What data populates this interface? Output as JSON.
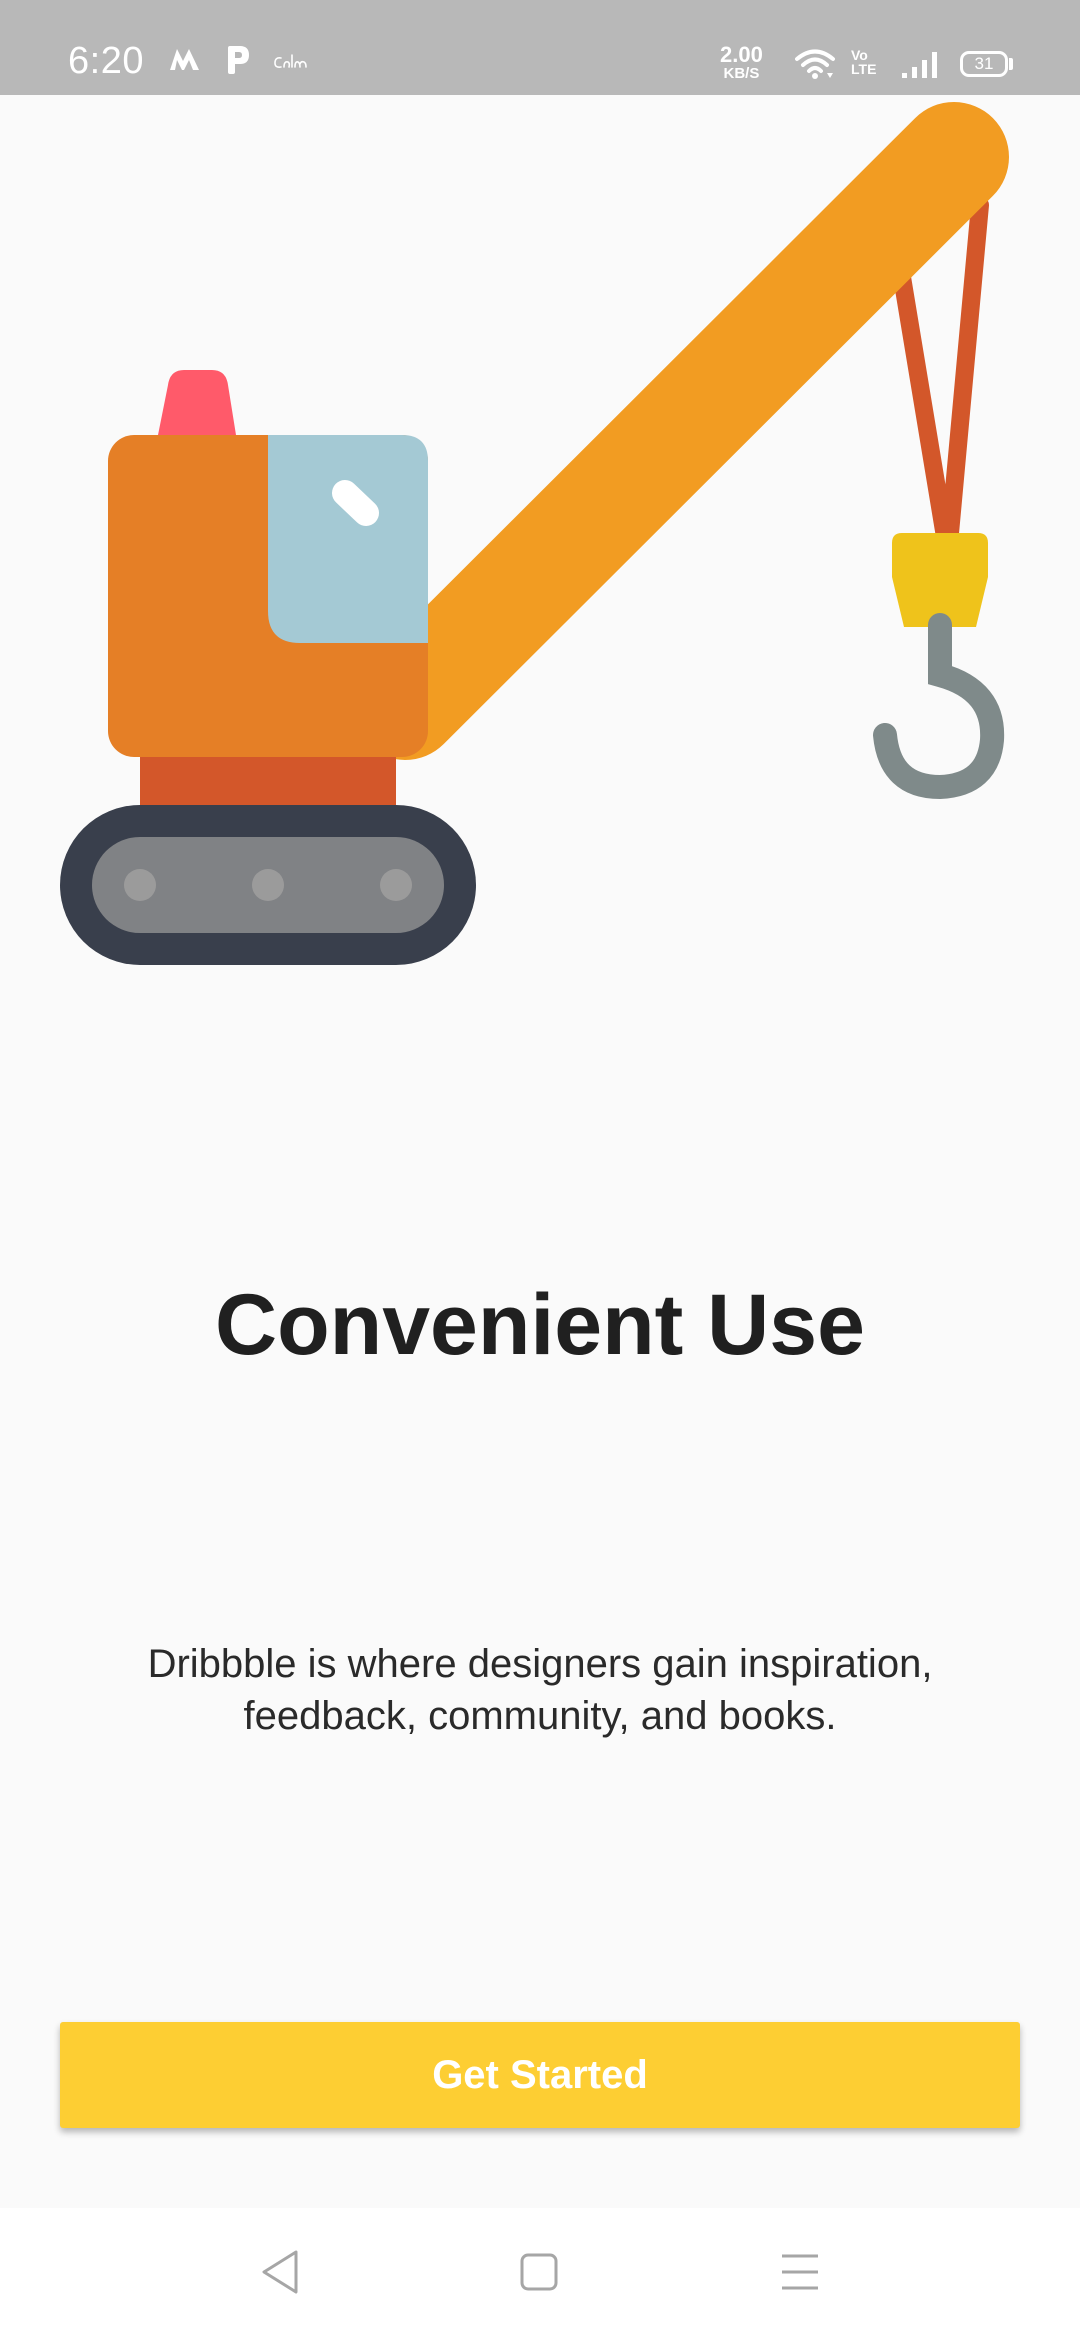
{
  "status_bar": {
    "time": "6:20",
    "net_speed_value": "2.00",
    "net_speed_unit": "KB/S",
    "volte_line1": "Vo",
    "volte_line2": "LTE",
    "battery_level": "31",
    "left_icons": [
      "m-app-icon",
      "p-app-icon",
      "calm-app-icon"
    ],
    "right_icons": [
      "wifi-icon",
      "volte-icon",
      "signal-icon",
      "battery-icon"
    ]
  },
  "illustration": {
    "subject": "crane",
    "colors": {
      "cab_body": "#E57F26",
      "window": "#A4C9D4",
      "beacon": "#FF5A6A",
      "boom": "#F29C22",
      "cable": "#D3572A",
      "hook_block": "#EFC31B",
      "hook": "#7F8A8A",
      "track_outer": "#393F4C",
      "track_inner": "#808285",
      "track_wheels": "#9B9B9B",
      "chassis": "#D3572A"
    }
  },
  "onboarding": {
    "title": "Convenient Use",
    "description": "Dribbble is where designers gain inspiration, feedback, community, and books.",
    "cta_label": "Get Started"
  },
  "nav_bar": {
    "back_icon": "back-triangle-icon",
    "home_icon": "home-square-icon",
    "recents_icon": "menu-lines-icon"
  },
  "colors": {
    "status_bar_bg": "#B8B8B8",
    "page_bg": "#FAFAFA",
    "accent": "#FDCE33",
    "title_text": "#202020",
    "body_text": "#2A2A2A"
  }
}
